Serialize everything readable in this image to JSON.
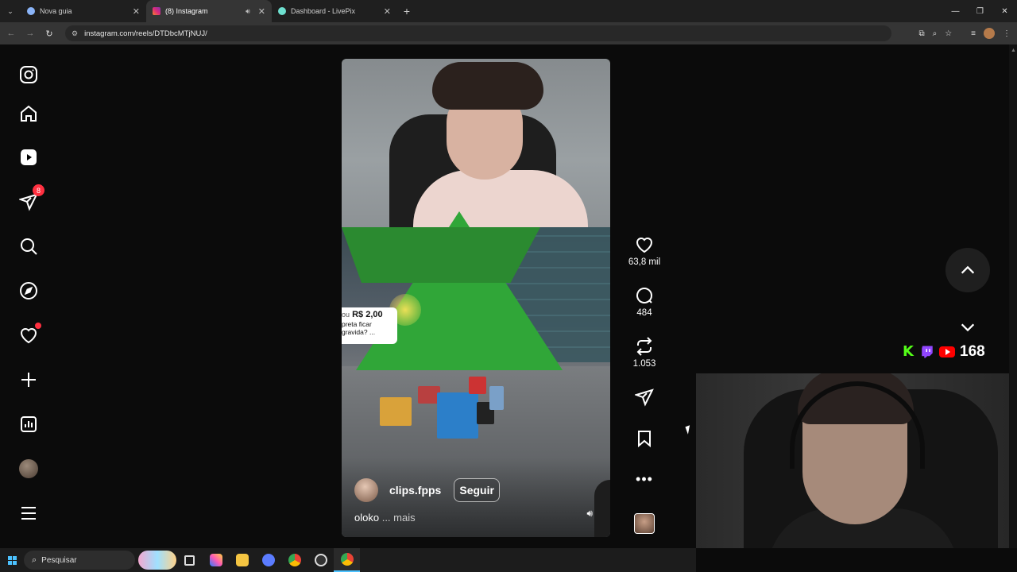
{
  "browser": {
    "tabs": [
      {
        "title": "Nova guia",
        "active": false,
        "favicon": "globe-icon"
      },
      {
        "title": "(8) Instagram",
        "active": true,
        "favicon": "instagram-icon"
      },
      {
        "title": "Dashboard - LivePix",
        "active": false,
        "favicon": "livepix-icon"
      }
    ],
    "url": "instagram.com/reels/DTDbcMTjNUJ/"
  },
  "sidebar": {
    "notifications_badge": "8",
    "items": [
      "instagram-logo",
      "home",
      "reels",
      "messages",
      "search",
      "explore",
      "notifications",
      "create",
      "dashboard",
      "profile",
      "more"
    ]
  },
  "reel": {
    "author": "clips.fpps",
    "follow_label": "Seguir",
    "caption": "oloko",
    "caption_more": "... mais",
    "donation": {
      "prefix": "ou",
      "amount": "R$ 2,00",
      "message_line1": "preta ficar",
      "message_line2": "gravida? ..."
    }
  },
  "actions": {
    "likes": "63,8 mil",
    "comments": "484",
    "reposts": "1.053"
  },
  "stream": {
    "viewers": "168"
  },
  "taskbar": {
    "search_placeholder": "Pesquisar"
  },
  "colors": {
    "accent": "#ff3040",
    "background": "#0b0b0b",
    "kick": "#53fc18",
    "twitch": "#9146ff",
    "youtube": "#ff0000"
  }
}
